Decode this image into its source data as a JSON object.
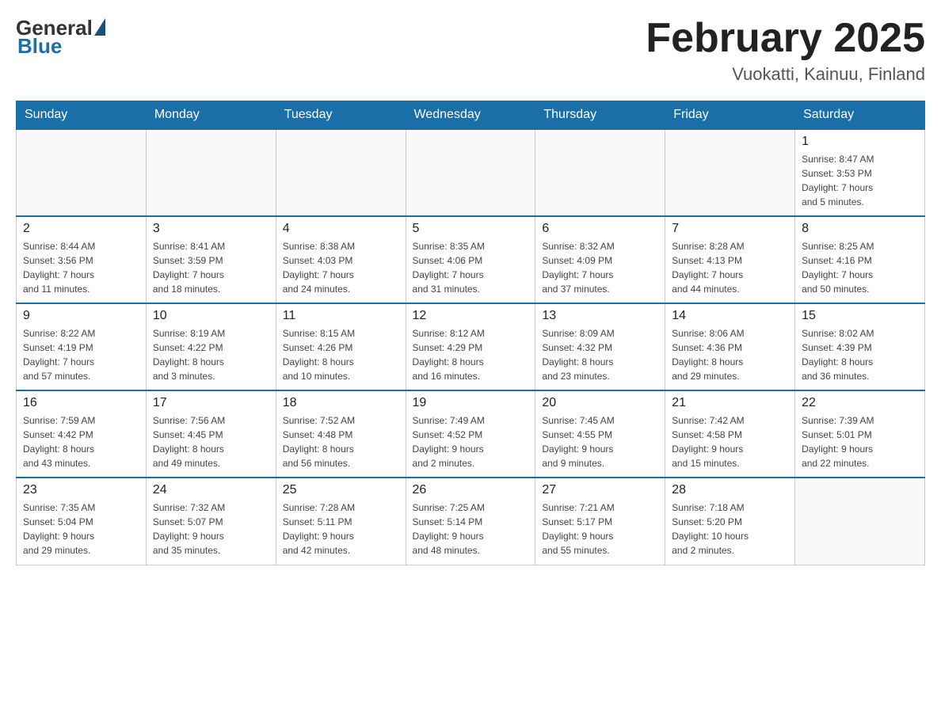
{
  "logo": {
    "general": "General",
    "blue": "Blue"
  },
  "header": {
    "title": "February 2025",
    "location": "Vuokatti, Kainuu, Finland"
  },
  "weekdays": [
    "Sunday",
    "Monday",
    "Tuesday",
    "Wednesday",
    "Thursday",
    "Friday",
    "Saturday"
  ],
  "weeks": [
    [
      {
        "day": "",
        "info": ""
      },
      {
        "day": "",
        "info": ""
      },
      {
        "day": "",
        "info": ""
      },
      {
        "day": "",
        "info": ""
      },
      {
        "day": "",
        "info": ""
      },
      {
        "day": "",
        "info": ""
      },
      {
        "day": "1",
        "info": "Sunrise: 8:47 AM\nSunset: 3:53 PM\nDaylight: 7 hours\nand 5 minutes."
      }
    ],
    [
      {
        "day": "2",
        "info": "Sunrise: 8:44 AM\nSunset: 3:56 PM\nDaylight: 7 hours\nand 11 minutes."
      },
      {
        "day": "3",
        "info": "Sunrise: 8:41 AM\nSunset: 3:59 PM\nDaylight: 7 hours\nand 18 minutes."
      },
      {
        "day": "4",
        "info": "Sunrise: 8:38 AM\nSunset: 4:03 PM\nDaylight: 7 hours\nand 24 minutes."
      },
      {
        "day": "5",
        "info": "Sunrise: 8:35 AM\nSunset: 4:06 PM\nDaylight: 7 hours\nand 31 minutes."
      },
      {
        "day": "6",
        "info": "Sunrise: 8:32 AM\nSunset: 4:09 PM\nDaylight: 7 hours\nand 37 minutes."
      },
      {
        "day": "7",
        "info": "Sunrise: 8:28 AM\nSunset: 4:13 PM\nDaylight: 7 hours\nand 44 minutes."
      },
      {
        "day": "8",
        "info": "Sunrise: 8:25 AM\nSunset: 4:16 PM\nDaylight: 7 hours\nand 50 minutes."
      }
    ],
    [
      {
        "day": "9",
        "info": "Sunrise: 8:22 AM\nSunset: 4:19 PM\nDaylight: 7 hours\nand 57 minutes."
      },
      {
        "day": "10",
        "info": "Sunrise: 8:19 AM\nSunset: 4:22 PM\nDaylight: 8 hours\nand 3 minutes."
      },
      {
        "day": "11",
        "info": "Sunrise: 8:15 AM\nSunset: 4:26 PM\nDaylight: 8 hours\nand 10 minutes."
      },
      {
        "day": "12",
        "info": "Sunrise: 8:12 AM\nSunset: 4:29 PM\nDaylight: 8 hours\nand 16 minutes."
      },
      {
        "day": "13",
        "info": "Sunrise: 8:09 AM\nSunset: 4:32 PM\nDaylight: 8 hours\nand 23 minutes."
      },
      {
        "day": "14",
        "info": "Sunrise: 8:06 AM\nSunset: 4:36 PM\nDaylight: 8 hours\nand 29 minutes."
      },
      {
        "day": "15",
        "info": "Sunrise: 8:02 AM\nSunset: 4:39 PM\nDaylight: 8 hours\nand 36 minutes."
      }
    ],
    [
      {
        "day": "16",
        "info": "Sunrise: 7:59 AM\nSunset: 4:42 PM\nDaylight: 8 hours\nand 43 minutes."
      },
      {
        "day": "17",
        "info": "Sunrise: 7:56 AM\nSunset: 4:45 PM\nDaylight: 8 hours\nand 49 minutes."
      },
      {
        "day": "18",
        "info": "Sunrise: 7:52 AM\nSunset: 4:48 PM\nDaylight: 8 hours\nand 56 minutes."
      },
      {
        "day": "19",
        "info": "Sunrise: 7:49 AM\nSunset: 4:52 PM\nDaylight: 9 hours\nand 2 minutes."
      },
      {
        "day": "20",
        "info": "Sunrise: 7:45 AM\nSunset: 4:55 PM\nDaylight: 9 hours\nand 9 minutes."
      },
      {
        "day": "21",
        "info": "Sunrise: 7:42 AM\nSunset: 4:58 PM\nDaylight: 9 hours\nand 15 minutes."
      },
      {
        "day": "22",
        "info": "Sunrise: 7:39 AM\nSunset: 5:01 PM\nDaylight: 9 hours\nand 22 minutes."
      }
    ],
    [
      {
        "day": "23",
        "info": "Sunrise: 7:35 AM\nSunset: 5:04 PM\nDaylight: 9 hours\nand 29 minutes."
      },
      {
        "day": "24",
        "info": "Sunrise: 7:32 AM\nSunset: 5:07 PM\nDaylight: 9 hours\nand 35 minutes."
      },
      {
        "day": "25",
        "info": "Sunrise: 7:28 AM\nSunset: 5:11 PM\nDaylight: 9 hours\nand 42 minutes."
      },
      {
        "day": "26",
        "info": "Sunrise: 7:25 AM\nSunset: 5:14 PM\nDaylight: 9 hours\nand 48 minutes."
      },
      {
        "day": "27",
        "info": "Sunrise: 7:21 AM\nSunset: 5:17 PM\nDaylight: 9 hours\nand 55 minutes."
      },
      {
        "day": "28",
        "info": "Sunrise: 7:18 AM\nSunset: 5:20 PM\nDaylight: 10 hours\nand 2 minutes."
      },
      {
        "day": "",
        "info": ""
      }
    ]
  ]
}
